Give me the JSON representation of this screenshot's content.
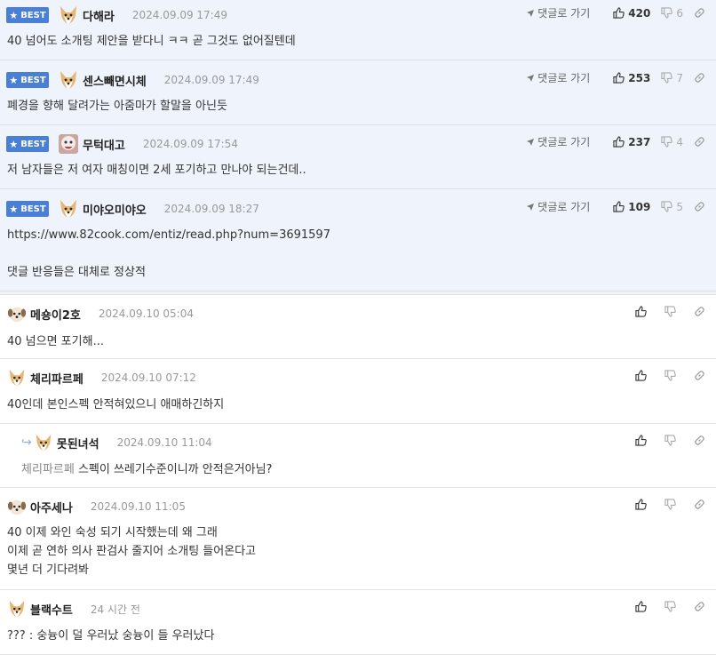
{
  "best_label": "BEST",
  "goto_label": "댓글로 가기",
  "comments": [
    {
      "best": true,
      "nick": "다해라",
      "date": "2024.09.09 17:49",
      "up": "420",
      "down": "6",
      "text": "40 넘어도 소개팅 제안을 받다니 ㅋㅋ 곧 그것도 없어질텐데",
      "avatar": "dog"
    },
    {
      "best": true,
      "nick": "센스빼면시체",
      "date": "2024.09.09 17:49",
      "up": "253",
      "down": "7",
      "text": "폐경을 향해 달려가는 아줌마가 할말을 아닌듯",
      "avatar": "dog"
    },
    {
      "best": true,
      "nick": "무턱대고",
      "date": "2024.09.09 17:54",
      "up": "237",
      "down": "4",
      "text": "저 남자들은 저 여자 매칭이면 2세 포기하고 만나야 되는건데..",
      "avatar": "photo"
    },
    {
      "best": true,
      "nick": "미야오미야오",
      "date": "2024.09.09 18:27",
      "up": "109",
      "down": "5",
      "text": "https://www.82cook.com/entiz/read.php?num=3691597\n\n댓글 반응들은 대체로 정상적",
      "avatar": "dog"
    },
    {
      "best": false,
      "nick": "메숑이2호",
      "date": "2024.09.10 05:04",
      "text": "40 넘으면 포기해...",
      "avatar": "puppy"
    },
    {
      "best": false,
      "nick": "체리파르페",
      "date": "2024.09.10 07:12",
      "text": "40인데 본인스펙 안적혀있으니 애매하긴하지",
      "avatar": "dog"
    },
    {
      "best": false,
      "reply": true,
      "nick": "못된녀석",
      "date": "2024.09.10 11:04",
      "parent": "체리파르페",
      "text": "스펙이 쓰레기수준이니까 안적은거아님?",
      "avatar": "dog"
    },
    {
      "best": false,
      "nick": "아주세나",
      "date": "2024.09.10 11:05",
      "text": "40 이제 와인 숙성 되기 시작했는데 왜 그래\n이제 곧 연하 의사 판검사 줄지어 소개팅 들어온다고\n몇년 더 기다려봐",
      "avatar": "puppy"
    },
    {
      "best": false,
      "nick": "블랙수트",
      "date": "24 시간 전",
      "text": "??? : 숭늉이 덜 우러났 숭늉이 들 우러났다",
      "avatar": "dog"
    }
  ],
  "colors": {
    "best_badge": "#4a7fd6",
    "best_bg": "#eef3fc"
  }
}
